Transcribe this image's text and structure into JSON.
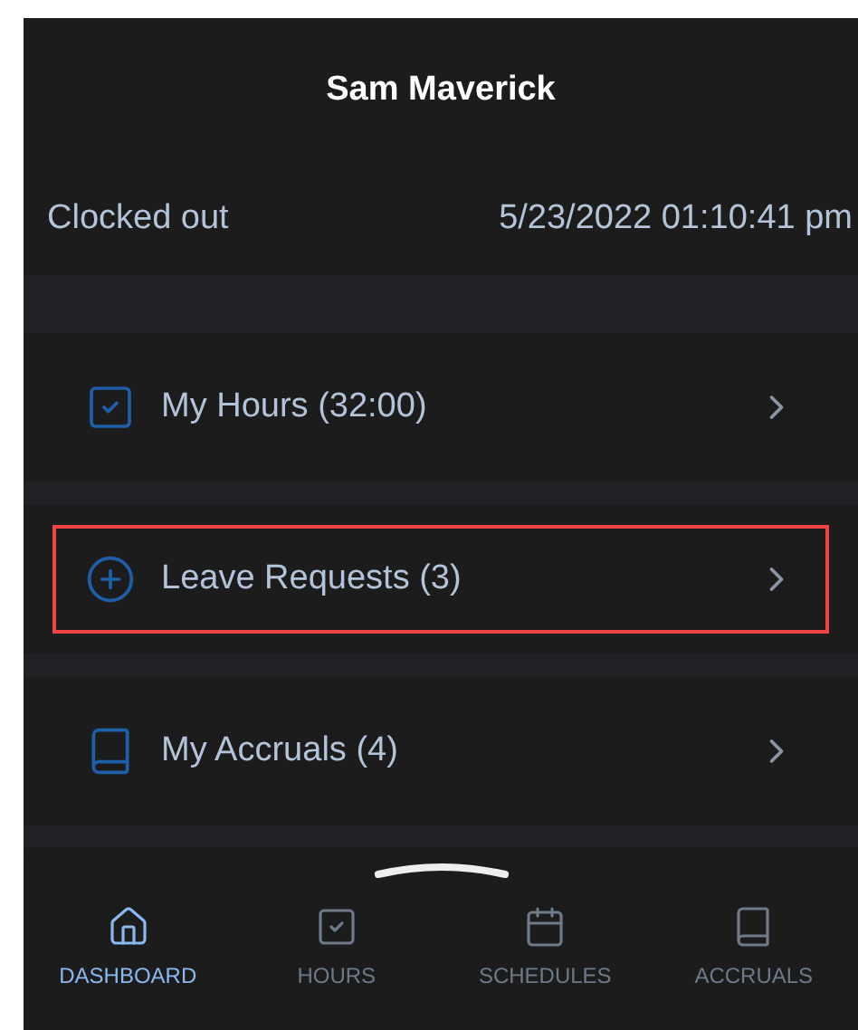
{
  "header": {
    "title": "Sam Maverick"
  },
  "status": {
    "label": "Clocked out",
    "timestamp": "5/23/2022 01:10:41 pm"
  },
  "menu_items": [
    {
      "kind": "hours",
      "label": "My Hours (32:00)",
      "highlighted": false
    },
    {
      "kind": "leave",
      "label": "Leave Requests (3)",
      "highlighted": true
    },
    {
      "kind": "accruals",
      "label": "My Accruals (4)",
      "highlighted": false
    }
  ],
  "bottom_nav": [
    {
      "kind": "dashboard",
      "label": "DASHBOARD",
      "selected": true
    },
    {
      "kind": "hours",
      "label": "HOURS",
      "selected": false
    },
    {
      "kind": "schedules",
      "label": "SCHEDULES",
      "selected": false
    },
    {
      "kind": "accruals",
      "label": "ACCRUALS",
      "selected": false
    }
  ]
}
